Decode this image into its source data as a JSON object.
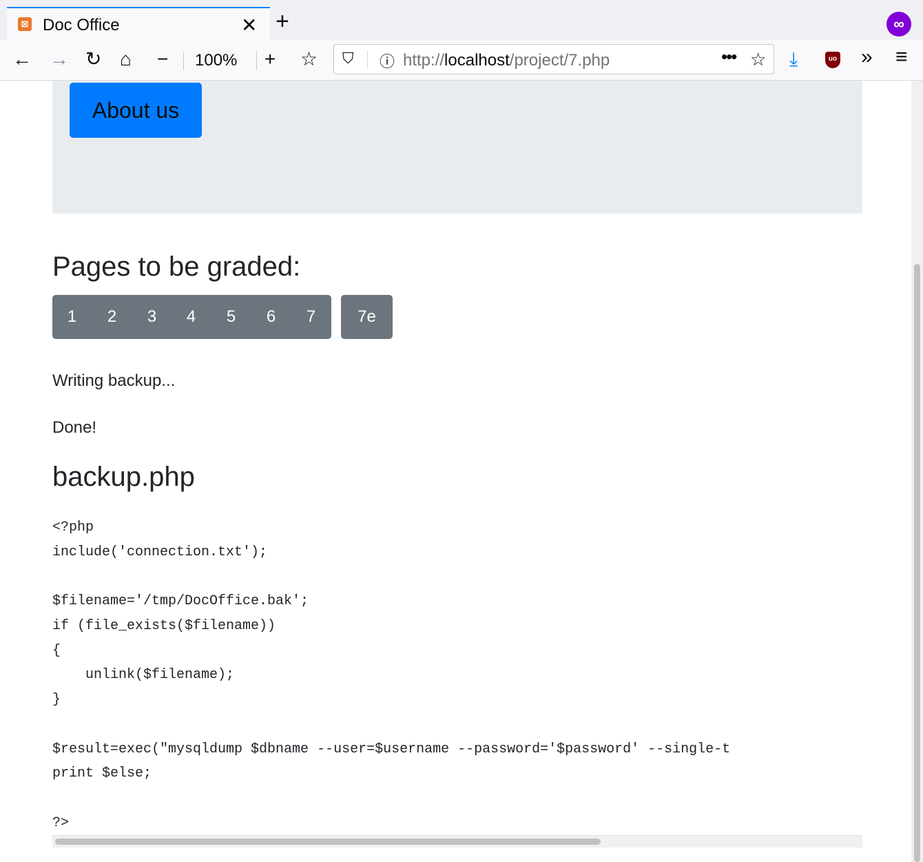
{
  "browser": {
    "tab": {
      "title": "Doc Office",
      "favicon": "xampp-icon",
      "close_glyph": "✕"
    },
    "new_tab_glyph": "+",
    "private_glyph": "∞",
    "nav": {
      "back_glyph": "←",
      "forward_glyph": "→",
      "reload_glyph": "↻",
      "home_glyph": "⌂",
      "zoom_out_glyph": "−",
      "zoom_level": "100%",
      "zoom_in_glyph": "+",
      "reader_glyph": "☆"
    },
    "urlbar": {
      "shield_glyph": "⛉",
      "info_glyph": "ⓘ",
      "url_prefix": "http://",
      "url_host": "localhost",
      "url_path": "/project/7.php",
      "more_glyph": "•••",
      "star_glyph": "☆"
    },
    "toolbar": {
      "download_glyph": "⤓",
      "ublock_label": "uo",
      "overflow_glyph": "»",
      "menu_glyph": "≡"
    }
  },
  "page": {
    "about_button": "About us",
    "pages_heading": "Pages to be graded:",
    "page_buttons": [
      "1",
      "2",
      "3",
      "4",
      "5",
      "6",
      "7"
    ],
    "extra_button": "7e",
    "status_lines": [
      "Writing backup...",
      "Done!"
    ],
    "file_heading": "backup.php",
    "code_lines": [
      "<?php",
      "include('connection.txt');",
      "",
      "$filename='/tmp/DocOffice.bak';",
      "if (file_exists($filename))",
      "{",
      "    unlink($filename);",
      "}",
      "",
      "$result=exec(\"mysqldump $dbname --user=$username --password='$password' --single-t",
      "print $else;",
      "",
      "?>"
    ]
  },
  "colors": {
    "accent": "#0a84ff",
    "primary_button": "#007bff",
    "secondary_button": "#6c757d",
    "jumbotron": "#e9ecef",
    "private_browsing": "#8000d7"
  }
}
